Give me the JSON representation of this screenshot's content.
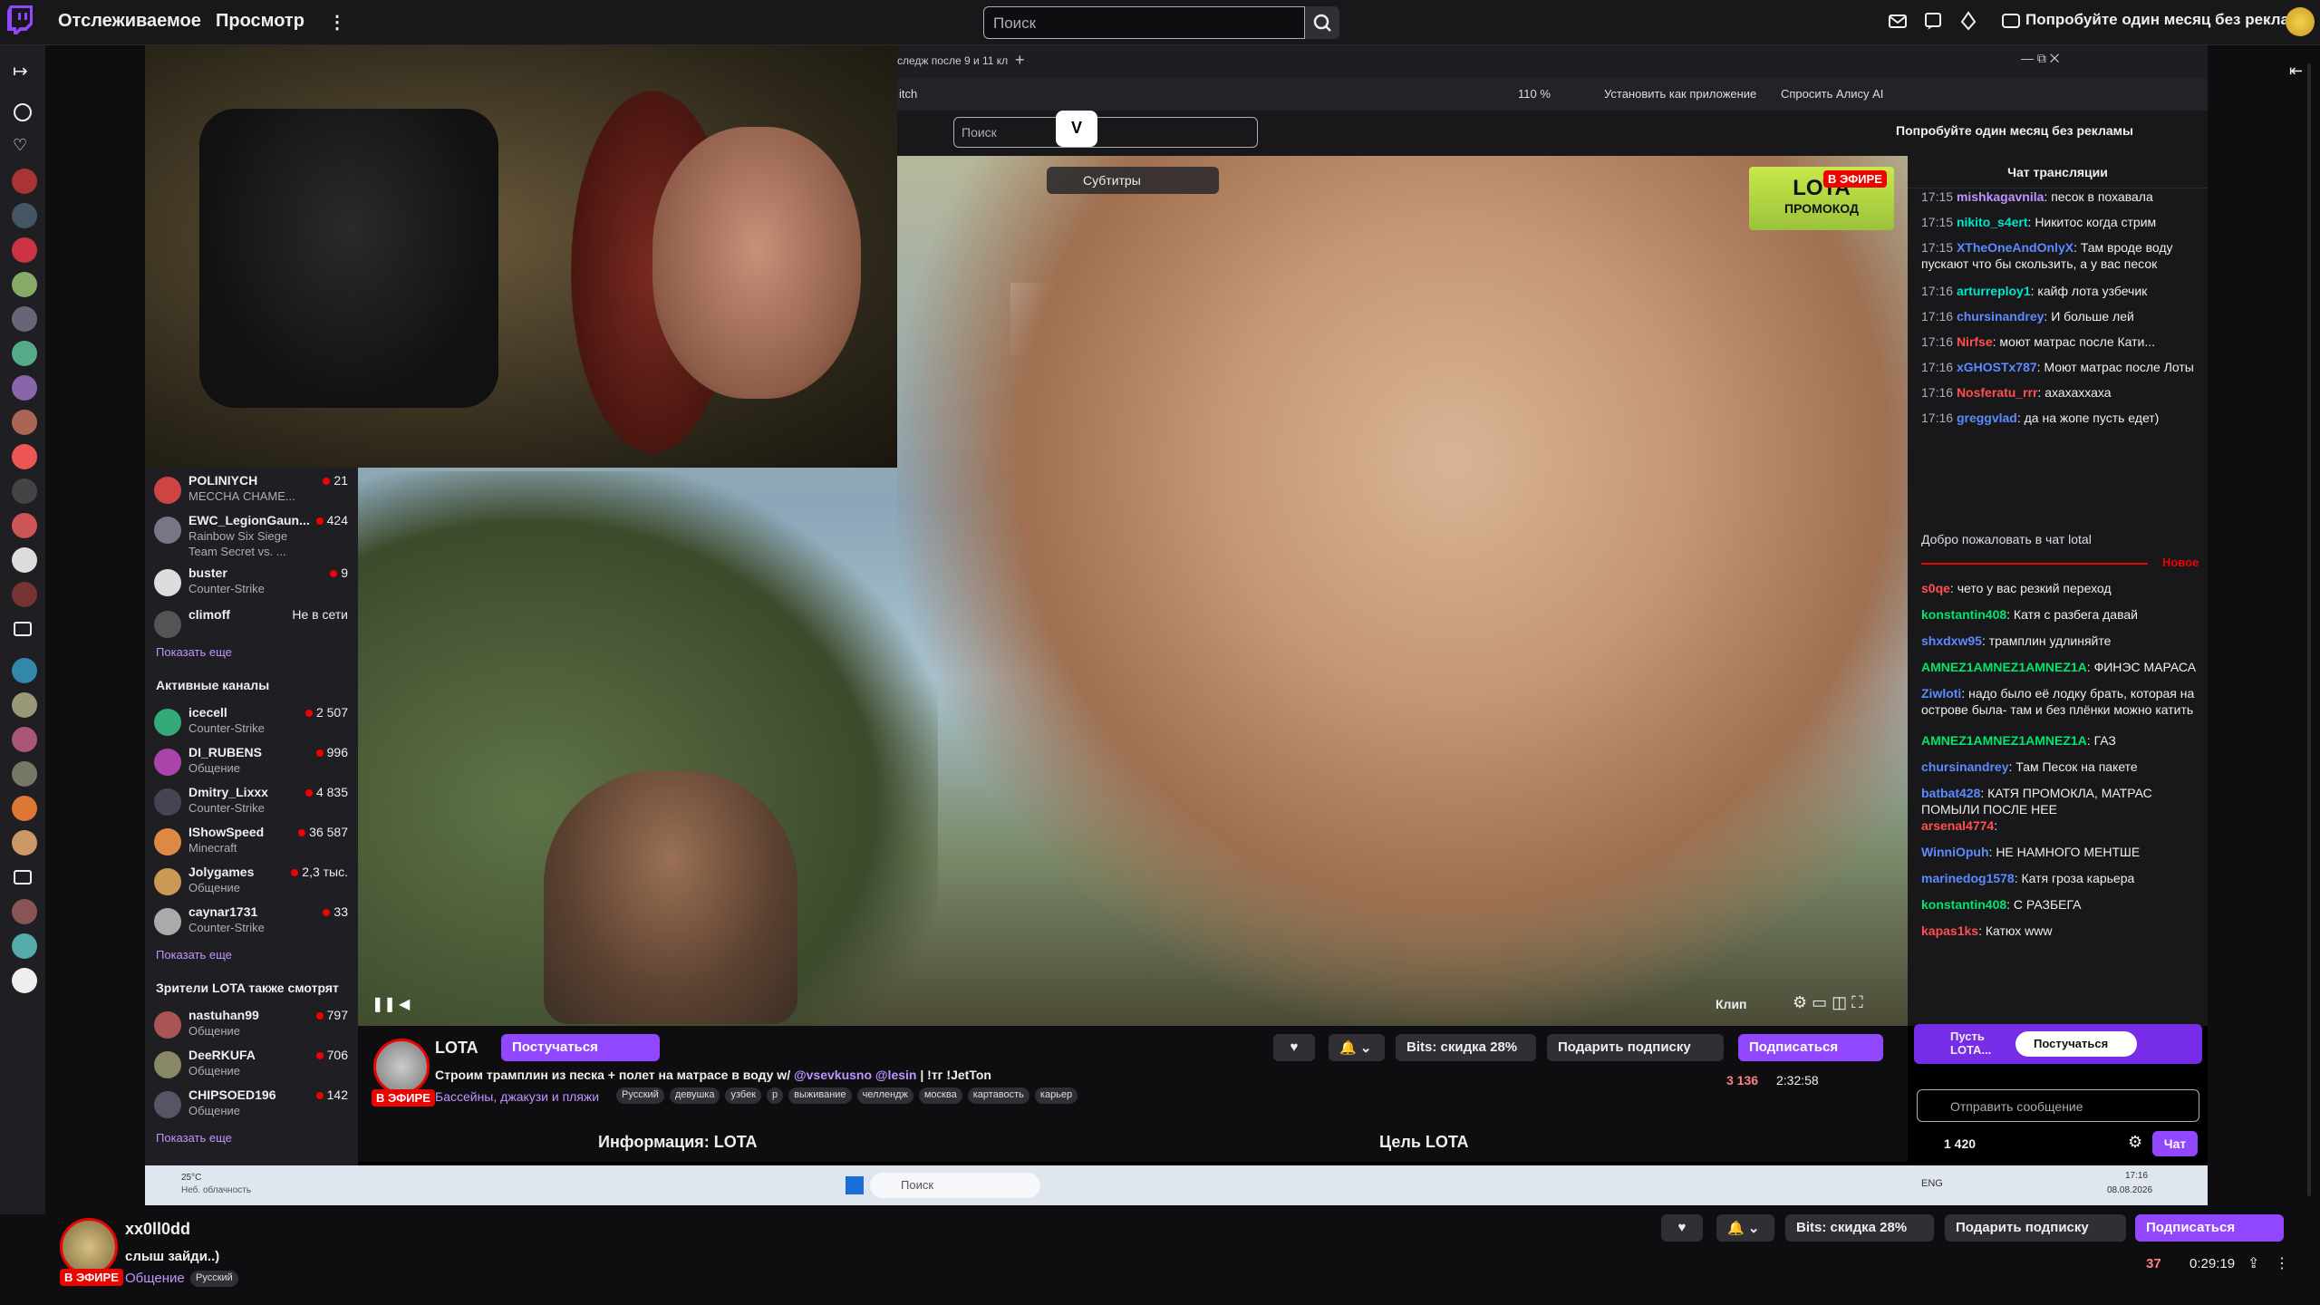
{
  "topbar": {
    "nav_following": "Отслеживаемое",
    "nav_browse": "Просмотр",
    "search_placeholder": "Поиск",
    "promo": "Попробуйте один месяц без рекламы"
  },
  "inner_browser": {
    "tab_title": "следж после 9 и 11 кл",
    "address": "itch",
    "zoom": "110 %",
    "install_app": "Установить как приложение",
    "ask_alice": "Спросить Алису AI"
  },
  "inner_twitch": {
    "search_placeholder": "Поиск",
    "promo": "Попробуйте один месяц без рекламы",
    "subtitles": "Субтитры",
    "overlay_brand": "LOTA",
    "overlay_sub": "ПРОМОКОД",
    "overlay_live": "В ЭФИРЕ",
    "clip": "Клип",
    "chat_title": "Чат трансляции",
    "chat_messages": [
      {
        "time": "17:15",
        "user": "mishkagavnila",
        "color": "#bf94ff",
        "text": "песок в похавала"
      },
      {
        "time": "17:15",
        "user": "nikito_s4ert",
        "color": "#00e5cb",
        "text": "Никитос когда стрим"
      },
      {
        "time": "17:15",
        "user": "XTheOneAndOnlyX",
        "color": "#5c8bff",
        "text": "Там вроде воду пускают что бы скользить, а у вас песок"
      },
      {
        "time": "17:16",
        "user": "arturreploy1",
        "color": "#00e5cb",
        "text": "кайф лота узбечик"
      },
      {
        "time": "17:16",
        "user": "chursinandrey",
        "color": "#5c8bff",
        "text": "И больше лей"
      },
      {
        "time": "17:16",
        "user": "Nirfse",
        "color": "#ff4f4f",
        "text": "моют матрас после Кати..."
      },
      {
        "time": "17:16",
        "user": "xGHOSTx787",
        "color": "#5c8bff",
        "text": "Моют матрас после Лоты"
      },
      {
        "time": "17:16",
        "user": "Nosferatu_rrr",
        "color": "#ff4f4f",
        "text": "ахахаххаха"
      },
      {
        "time": "17:16",
        "user": "greggvlad",
        "color": "#5c8bff",
        "text": "да на жопе пусть едет)"
      }
    ],
    "welcome": "Добро пожаловать в чат lotal",
    "new_marker": "Новое",
    "chat_messages_new": [
      {
        "user": "s0qe",
        "color": "#ff4f4f",
        "text": "чето у вас резкий переход"
      },
      {
        "user": "konstantin408",
        "color": "#00e56b",
        "text": "Катя с разбега давай"
      },
      {
        "user": "shxdxw95",
        "color": "#5c8bff",
        "text": "трамплин удлиняйте"
      },
      {
        "user": "AMNEZ1AMNEZ1AMNEZ1A",
        "color": "#00e56b",
        "text": "ФИНЭС МАРАСА"
      },
      {
        "user": "Ziwloti",
        "color": "#5c8bff",
        "text": "надо было её лодку брать, которая на острове была- там и без плёнки можно катить"
      },
      {
        "user": "AMNEZ1AMNEZ1AMNEZ1A",
        "color": "#00e56b",
        "text": "ГАЗ"
      },
      {
        "user": "chursinandrey",
        "color": "#5c8bff",
        "text": "Там Песок на пакете"
      },
      {
        "user": "batbat428",
        "color": "#5c8bff",
        "text": "КАТЯ ПРОМОКЛА, МАТРАС ПОМЫЛИ ПОСЛЕ НЕЕ"
      },
      {
        "user": "arsenal4774",
        "color": "#ff4f4f",
        "text": ""
      },
      {
        "user": "WinniOpuh",
        "color": "#5c8bff",
        "text": "НЕ НАМНОГО МЕНТШЕ"
      },
      {
        "user": "marinedog1578",
        "color": "#5c8bff",
        "text": "Катя гроза карьера"
      },
      {
        "user": "konstantin408",
        "color": "#00e56b",
        "text": "С РАЗБЕГА"
      },
      {
        "user": "kapas1ks",
        "color": "#ff4f4f",
        "text": "Катюх www"
      }
    ],
    "chat_prompt_name": "Пусть LOTA...",
    "chat_prompt_btn": "Постучаться",
    "chat_input_placeholder": "Отправить сообщение",
    "points": "1 420",
    "chat_button": "Чат",
    "channel": {
      "name": "LOTA",
      "knock": "Постучаться",
      "live": "В ЭФИРЕ",
      "title": "Строим трамплин из песка + полет на матрасе в воду w/",
      "mention1": "@vsevkusno",
      "mention2": "@lesin",
      "title_tail": "| !тг !JetTon",
      "category": "Бассейны, джакузи и пляжи",
      "tags": [
        "Русский",
        "девушка",
        "узбек",
        "р",
        "выживание",
        "челлендж",
        "москва",
        "картавость",
        "карьер"
      ],
      "viewers": "3 136",
      "uptime": "2:32:58",
      "bits": "Bits: скидка 28%",
      "gift": "Подарить подписку",
      "subscribe": "Подписаться",
      "info": "Информация: LOTA",
      "goal": "Цель LOTA"
    }
  },
  "followed": [
    {
      "name": "POLINIYCH",
      "game": "МЕССНА СНАМЕ...",
      "viewers": "21"
    },
    {
      "name": "EWC_LegionGaun...",
      "game": "Rainbow Six Siege",
      "game2": "Team Secret vs. ...",
      "viewers": "424"
    },
    {
      "name": "buster",
      "game": "Counter-Strike",
      "viewers": "9"
    },
    {
      "name": "climoff",
      "game": "",
      "viewers": "Не в сети"
    }
  ],
  "show_more_1": "Показать еще",
  "active_section": "Активные каналы",
  "active": [
    {
      "name": "icecell",
      "game": "Counter-Strike",
      "viewers": "2 507"
    },
    {
      "name": "DI_RUBENS",
      "game": "Общение",
      "viewers": "996"
    },
    {
      "name": "Dmitry_Lixxx",
      "game": "Counter-Strike",
      "viewers": "4 835"
    },
    {
      "name": "IShowSpeed",
      "game": "Minecraft",
      "viewers": "36 587"
    },
    {
      "name": "Jolygames",
      "game": "Общение",
      "viewers": "2,3 тыс."
    },
    {
      "name": "caynar1731",
      "game": "Counter-Strike",
      "viewers": "33"
    }
  ],
  "show_more_2": "Показать еще",
  "also_section": "Зрители LOTA также смотрят",
  "also": [
    {
      "name": "nastuhan99",
      "game": "Общение",
      "viewers": "797"
    },
    {
      "name": "DeeRKUFA",
      "game": "Общение",
      "viewers": "706"
    },
    {
      "name": "CHIPSOED196",
      "game": "Общение",
      "viewers": "142"
    }
  ],
  "show_more_3": "Показать еще",
  "taskbar": {
    "weather_temp": "25°C",
    "weather_text": "Неб. облачность",
    "search": "Поиск",
    "lang": "ENG",
    "time": "17:16",
    "date": "08.08.2026"
  },
  "bottom": {
    "channel": "xx0ll0dd",
    "title": "слыш зайди..)",
    "live": "В ЭФИРЕ",
    "category": "Общение",
    "tag": "Русский",
    "bits": "Bits: скидка 28%",
    "gift": "Подарить подписку",
    "subscribe": "Подписаться",
    "viewers": "37",
    "uptime": "0:29:19"
  },
  "colors": {
    "accent": "#9147ff",
    "live": "#eb0400",
    "link": "#bf94ff"
  }
}
